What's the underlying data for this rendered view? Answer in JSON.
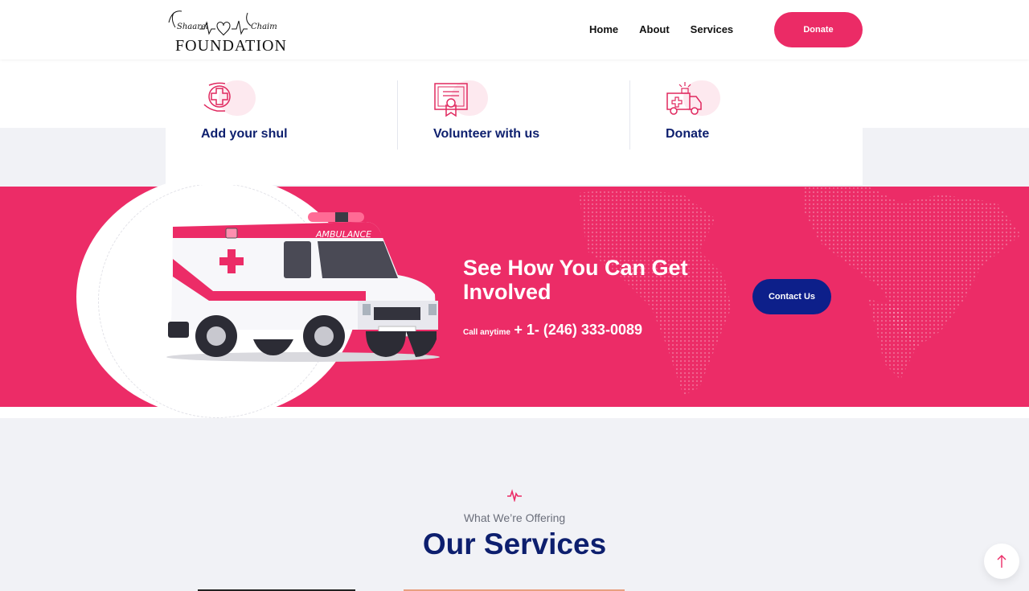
{
  "brand": {
    "script_left": "Shaarei",
    "script_right": "Chaim",
    "wordmark": "FOUNDATION"
  },
  "nav": {
    "items": [
      "Home",
      "About",
      "Services"
    ],
    "donate_label": "Donate"
  },
  "cards": [
    {
      "title": "Add your shul",
      "icon": "care-hands-icon"
    },
    {
      "title": "Volunteer with us",
      "icon": "certificate-icon"
    },
    {
      "title": "Donate",
      "icon": "ambulance-icon"
    }
  ],
  "cta": {
    "title": "See How You Can Get Involved",
    "call_label": "Call anytime",
    "phone": "+ 1- (246) 333-0089",
    "contact_label": "Contact Us",
    "ambulance_text": "AMBULANCE"
  },
  "services": {
    "eyebrow": "What We’re Offering",
    "title": "Our Services"
  },
  "colors": {
    "primary_pink": "#ec2c67",
    "navy": "#0d1f6e",
    "button_navy": "#0d1f8a"
  },
  "icons": {
    "scroll_top": "arrow-up-icon",
    "heartbeat": "pulse-icon"
  }
}
